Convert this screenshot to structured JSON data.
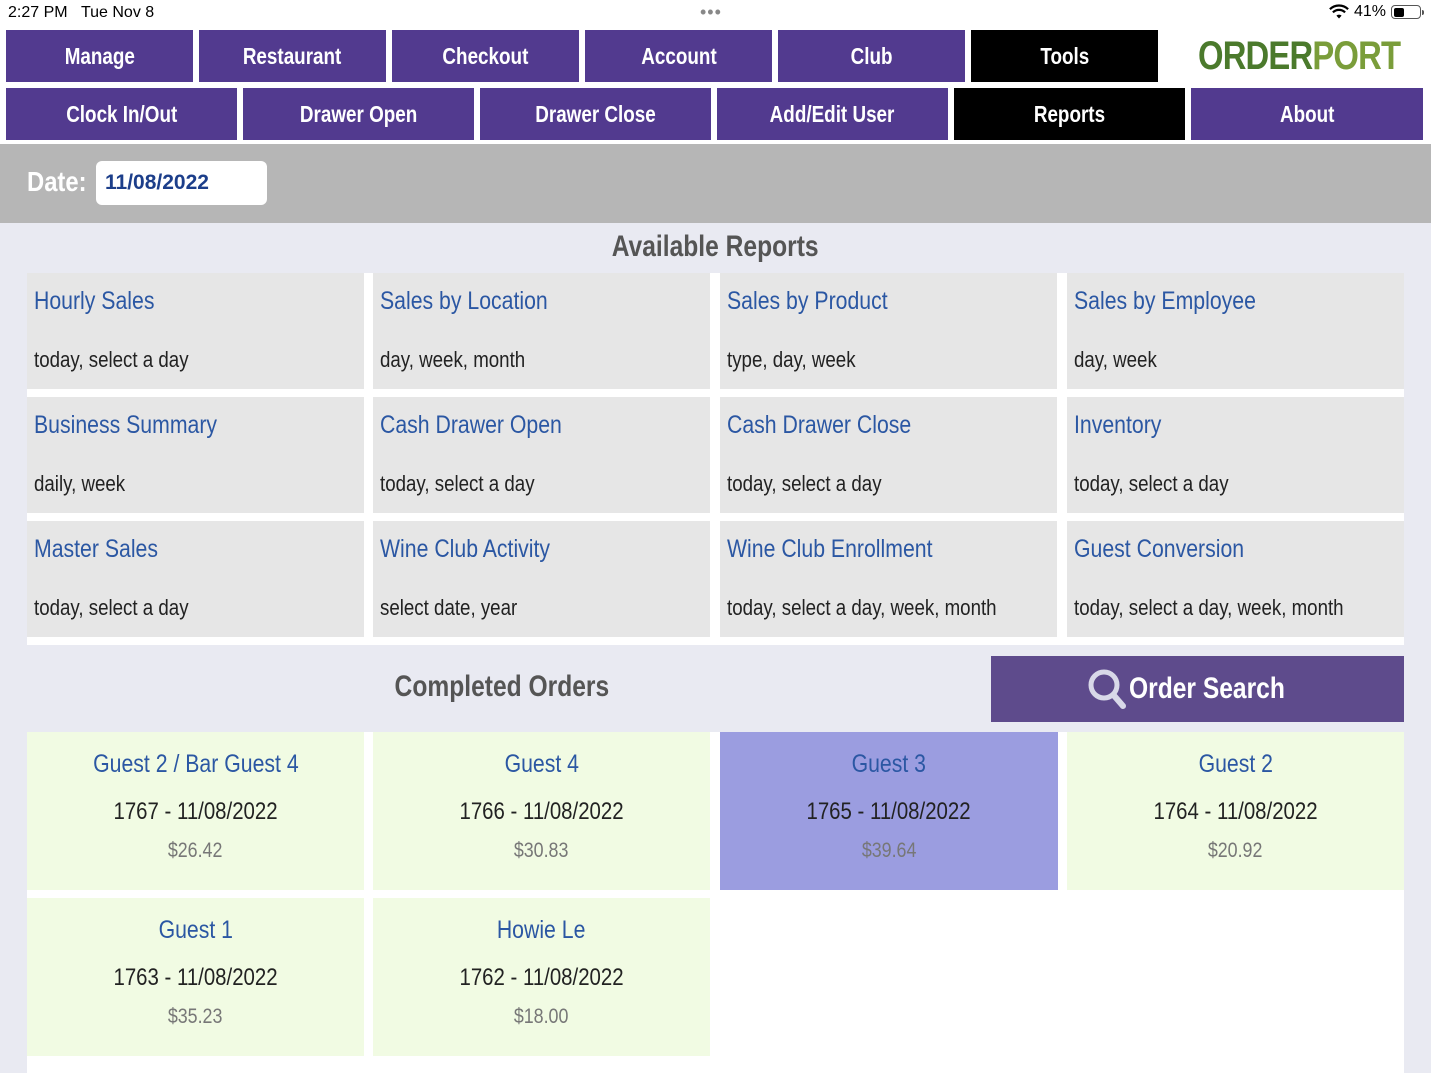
{
  "status_bar": {
    "time": "2:27 PM",
    "date": "Tue Nov 8",
    "dots": "•••",
    "battery": "41%",
    "battery_level": 0.41
  },
  "nav_primary": [
    {
      "label": "Manage",
      "active": false
    },
    {
      "label": "Restaurant",
      "active": false
    },
    {
      "label": "Checkout",
      "active": false
    },
    {
      "label": "Account",
      "active": false
    },
    {
      "label": "Club",
      "active": false
    },
    {
      "label": "Tools",
      "active": true
    }
  ],
  "nav_secondary": [
    {
      "label": "Clock In/Out",
      "active": false
    },
    {
      "label": "Drawer Open",
      "active": false
    },
    {
      "label": "Drawer Close",
      "active": false
    },
    {
      "label": "Add/Edit User",
      "active": false
    },
    {
      "label": "Reports",
      "active": true
    },
    {
      "label": "About",
      "active": false
    }
  ],
  "logo": {
    "part1": "ORDER",
    "part2": "PORT"
  },
  "date_filter": {
    "label": "Date:",
    "value": "11/08/2022"
  },
  "available_reports": {
    "title": "Available Reports",
    "items": [
      {
        "title": "Hourly Sales",
        "subtitle": "today, select a day"
      },
      {
        "title": "Sales by Location",
        "subtitle": "day, week, month"
      },
      {
        "title": "Sales by Product",
        "subtitle": "type, day, week"
      },
      {
        "title": "Sales by Employee",
        "subtitle": "day, week"
      },
      {
        "title": "Business Summary",
        "subtitle": "daily, week"
      },
      {
        "title": "Cash Drawer Open",
        "subtitle": "today, select a day"
      },
      {
        "title": "Cash Drawer Close",
        "subtitle": "today, select a day"
      },
      {
        "title": "Inventory",
        "subtitle": "today, select a day"
      },
      {
        "title": "Master Sales",
        "subtitle": "today, select a day"
      },
      {
        "title": "Wine Club Activity",
        "subtitle": "select date, year"
      },
      {
        "title": "Wine Club Enrollment",
        "subtitle": "today, select a day, week, month"
      },
      {
        "title": "Guest Conversion",
        "subtitle": "today, select a day, week, month"
      }
    ]
  },
  "completed_orders": {
    "title": "Completed Orders",
    "search_label": "Order Search",
    "items": [
      {
        "name": "Guest 2 / Bar Guest 4",
        "id": "1767 - 11/08/2022",
        "amount": "$26.42",
        "selected": false
      },
      {
        "name": "Guest 4",
        "id": "1766 - 11/08/2022",
        "amount": "$30.83",
        "selected": false
      },
      {
        "name": "Guest 3",
        "id": "1765 - 11/08/2022",
        "amount": "$39.64",
        "selected": true
      },
      {
        "name": "Guest 2",
        "id": "1764 - 11/08/2022",
        "amount": "$20.92",
        "selected": false
      },
      {
        "name": "Guest 1",
        "id": "1763 - 11/08/2022",
        "amount": "$35.23",
        "selected": false
      },
      {
        "name": "Howie Le",
        "id": "1762 - 11/08/2022",
        "amount": "$18.00",
        "selected": false
      }
    ]
  },
  "colors": {
    "nav": "#523a8f",
    "nav_active": "#000000",
    "link": "#2b57a3",
    "order_bg": "#f1fbe3",
    "order_selected": "#9b9de0",
    "search_button": "#5e4b8c"
  }
}
